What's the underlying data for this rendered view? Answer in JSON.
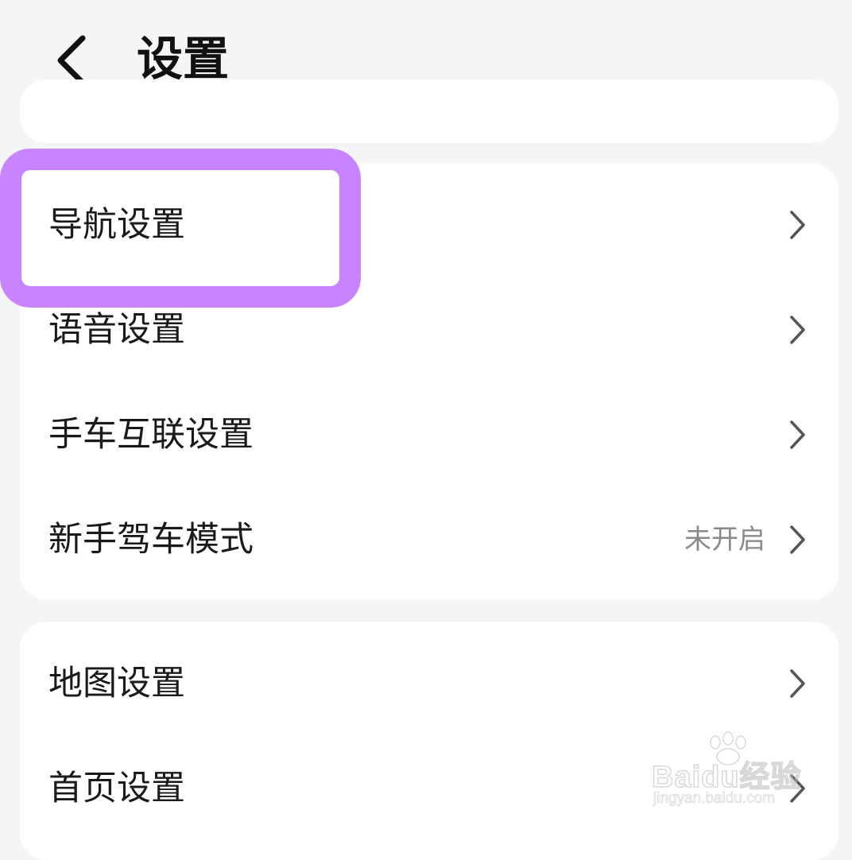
{
  "header": {
    "title": "设置",
    "back_icon": "chevron-left-icon"
  },
  "group1": {
    "items": [
      {
        "label": "导航设置",
        "value": "",
        "icon": "chevron-right-icon"
      },
      {
        "label": "语音设置",
        "value": "",
        "icon": "chevron-right-icon"
      },
      {
        "label": "手车互联设置",
        "value": "",
        "icon": "chevron-right-icon"
      },
      {
        "label": "新手驾车模式",
        "value": "未开启",
        "icon": "chevron-right-icon"
      }
    ]
  },
  "group2": {
    "items": [
      {
        "label": "地图设置",
        "value": "",
        "icon": "chevron-right-icon"
      },
      {
        "label": "首页设置",
        "value": "",
        "icon": "chevron-right-icon"
      }
    ]
  },
  "annotation": {
    "highlight_color": "#c884ff"
  },
  "watermark": {
    "logo": "Baidu经验",
    "url": "jingyan.baidu.com"
  },
  "colors": {
    "background": "#f4f5f7",
    "card": "#ffffff",
    "text": "#1a1a1a",
    "secondary_text": "#8a8a8a"
  }
}
